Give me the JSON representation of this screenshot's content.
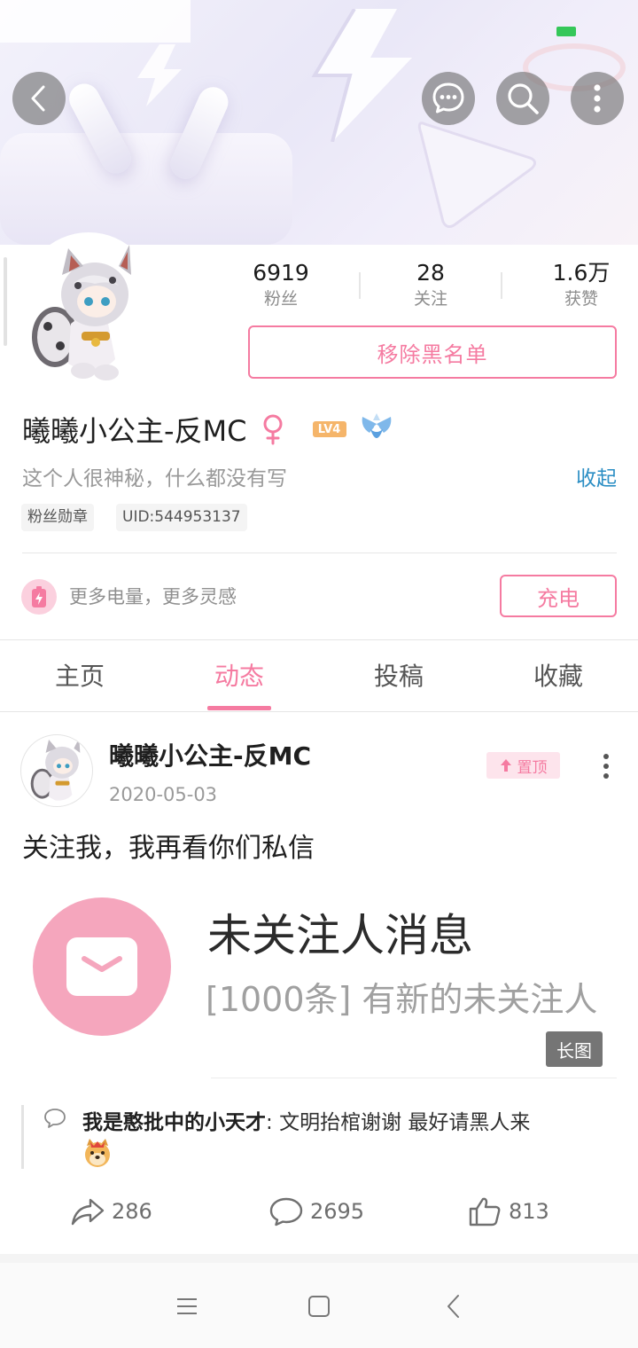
{
  "header": {
    "back_icon": "back-arrow-icon",
    "message_icon": "chat-bubble-icon",
    "search_icon": "search-icon",
    "more_icon": "more-vertical-icon"
  },
  "profile": {
    "stats": [
      {
        "value": "6919",
        "label": "粉丝"
      },
      {
        "value": "28",
        "label": "关注"
      },
      {
        "value": "1.6万",
        "label": "获赞"
      }
    ],
    "remove_blacklist_label": "移除黑名单",
    "name": "曦曦小公主-反MC",
    "level": "LV4",
    "bio": "这个人很神秘，什么都没有写",
    "collapse_label": "收起",
    "tags": [
      "粉丝勋章",
      "UID:544953137"
    ],
    "charge_text": "更多电量，更多灵感",
    "charge_button": "充电"
  },
  "tabs": [
    {
      "label": "主页",
      "active": false
    },
    {
      "label": "动态",
      "active": true
    },
    {
      "label": "投稿",
      "active": false
    },
    {
      "label": "收藏",
      "active": false
    }
  ],
  "post": {
    "author": "曦曦小公主-反MC",
    "date": "2020-05-03",
    "pin_label": "置顶",
    "text": "关注我，我再看你们私信",
    "image": {
      "title": "未关注人消息",
      "subtitle": "[1000条] 有新的未关注人",
      "long_badge": "长图"
    },
    "top_comment": {
      "user": "我是憨批中的小天才",
      "separator": ": ",
      "text": "文明抬棺谢谢 最好请黑人来"
    },
    "actions": {
      "share_count": "286",
      "comment_count": "2695",
      "like_count": "813"
    }
  },
  "colors": {
    "accent": "#f57ba1",
    "link": "#2b8ec4"
  }
}
